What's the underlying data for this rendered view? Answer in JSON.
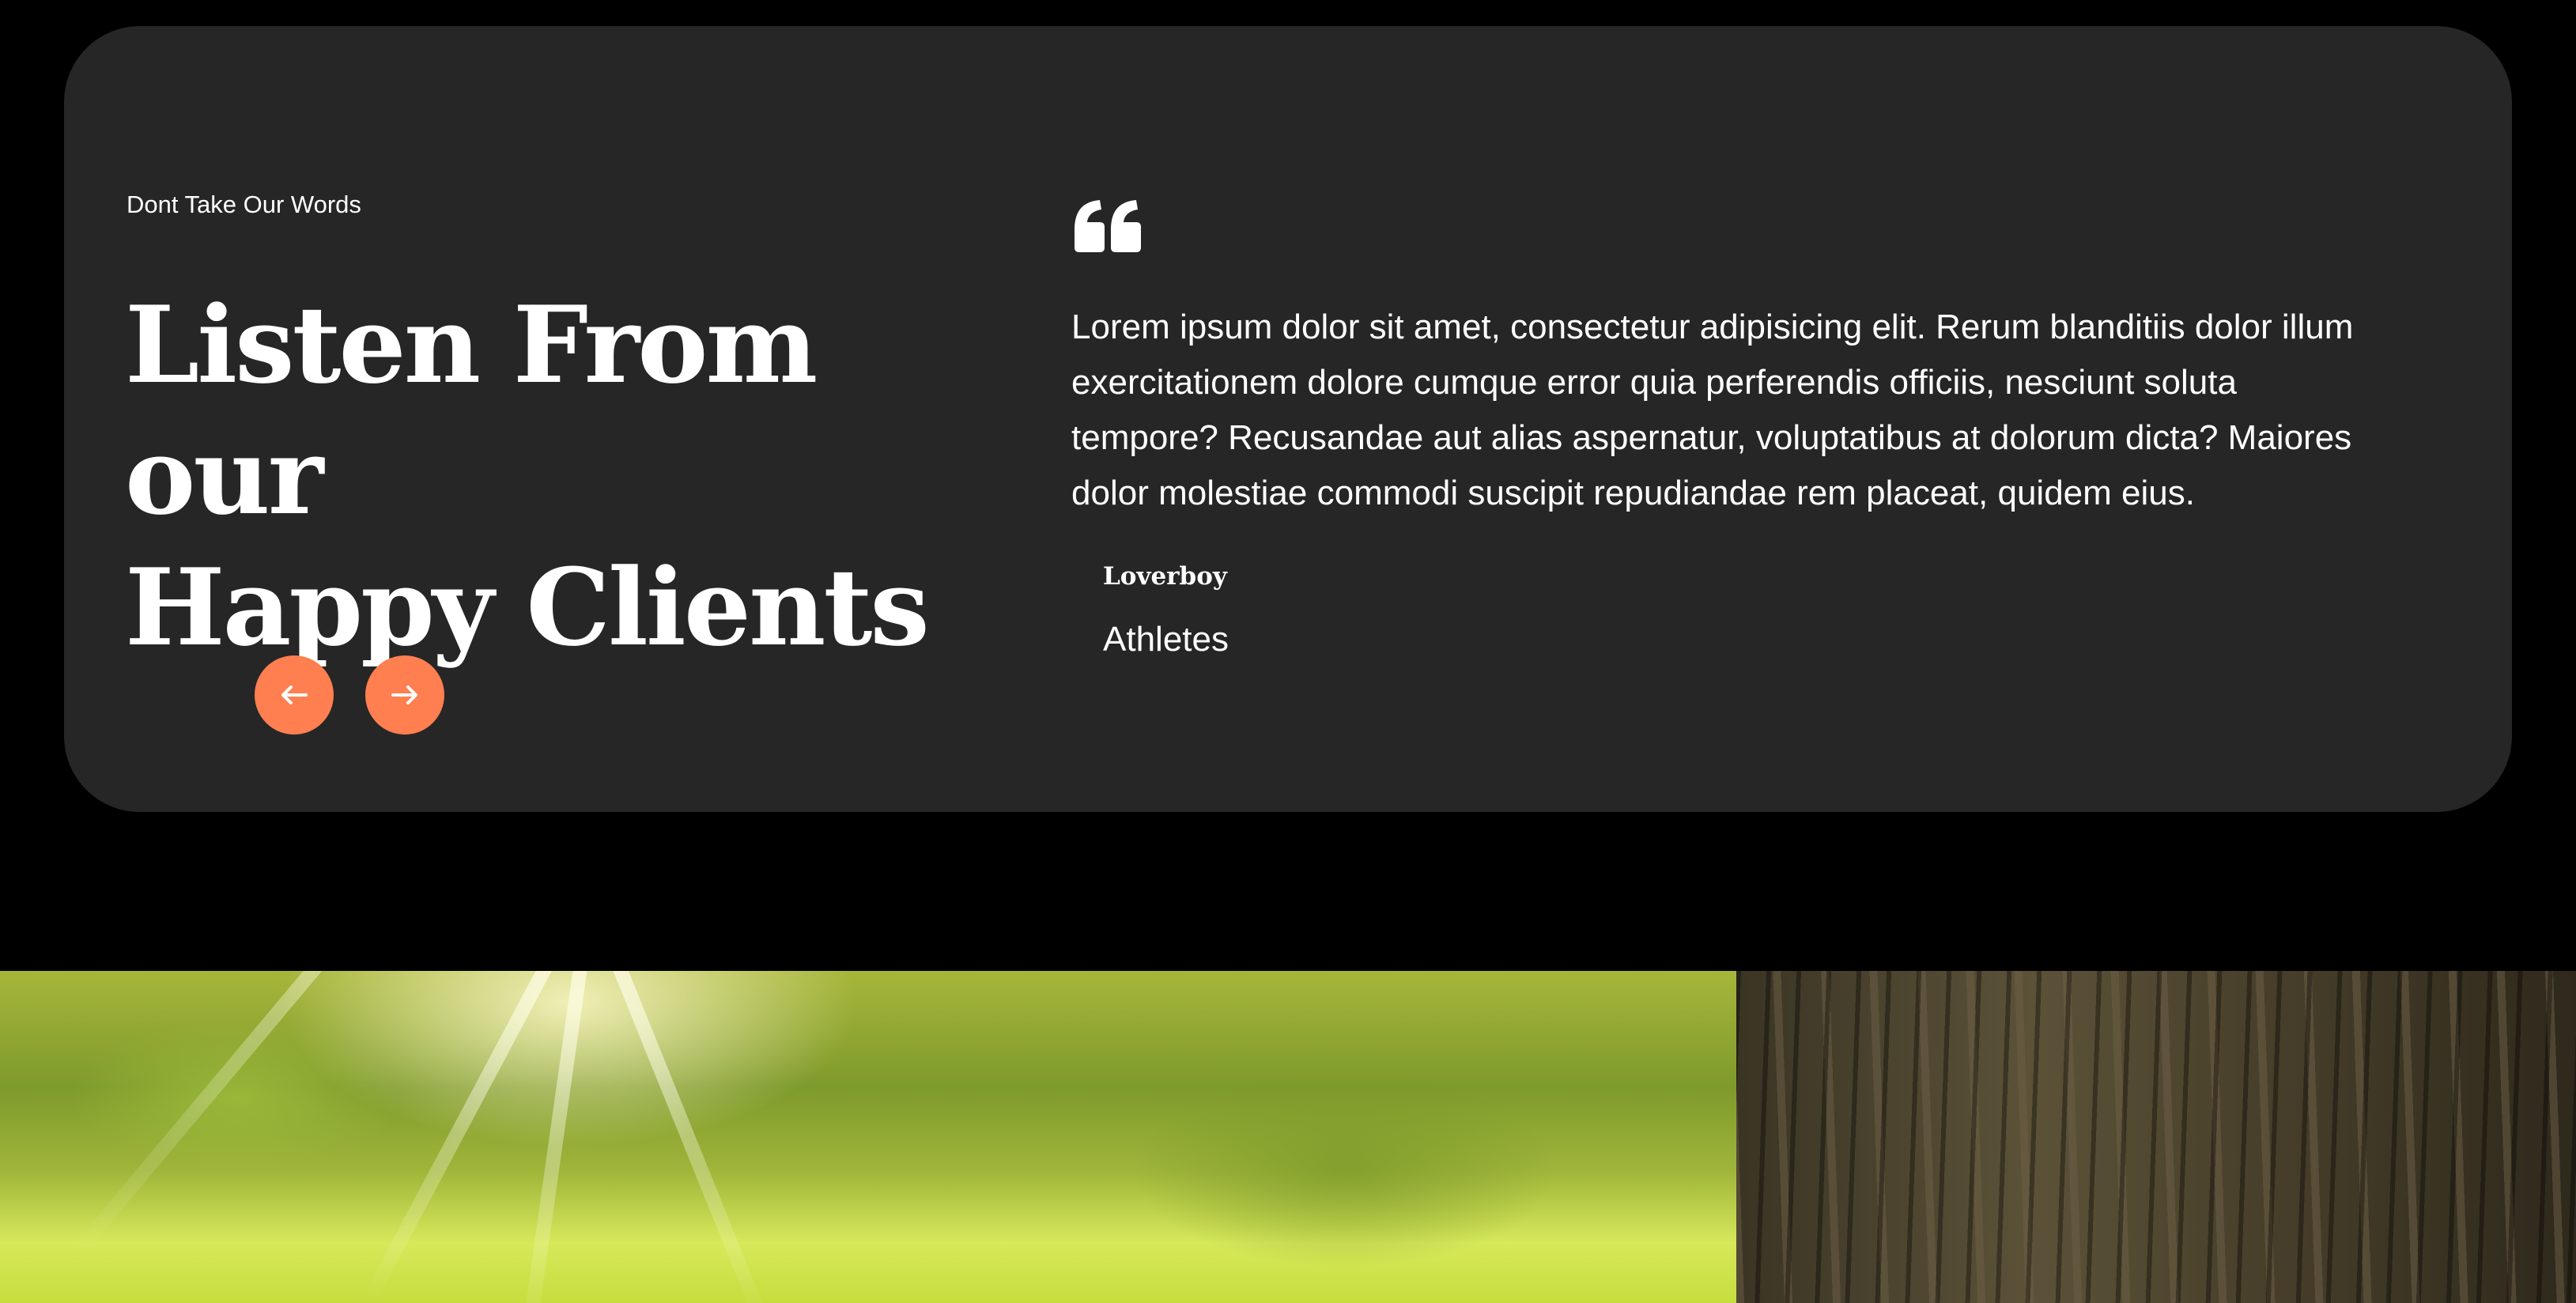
{
  "testimonials": {
    "eyebrow": "Dont Take Our Words",
    "heading_line1": "Listen From our",
    "heading_line2": "Happy Clients",
    "prev_icon": "arrow-left-icon",
    "next_icon": "arrow-right-icon",
    "quote_icon": "quote-icon",
    "accent_color": "#ff7f50",
    "card_color": "#262626",
    "quote": "Lorem ipsum dolor sit amet, consectetur adipisicing elit. Rerum blanditiis dolor illum exercitationem dolore cumque error quia perferendis officiis, nesciunt soluta tempore? Recusandae aut alias aspernatur, voluptatibus at dolorum dicta? Maiores dolor molestiae commodi suscipit repudiandae rem placeat, quidem eius.",
    "author_name": "Loverboy",
    "author_role": "Athletes"
  },
  "hero_image": {
    "subject": "sunlit forest with tree trunk"
  }
}
